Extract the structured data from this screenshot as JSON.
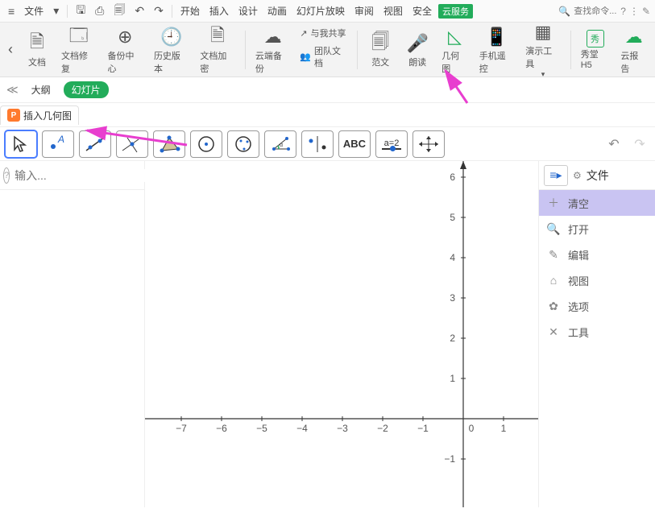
{
  "menubar": {
    "file": "文件",
    "tabs": [
      "开始",
      "插入",
      "设计",
      "动画",
      "幻灯片放映",
      "审阅",
      "视图",
      "安全"
    ],
    "cloud": "云服务",
    "search_placeholder": "查找命令..."
  },
  "ribbon": {
    "items": [
      {
        "label": "文档"
      },
      {
        "label": "文档修复"
      },
      {
        "label": "备份中心"
      },
      {
        "label": "历史版本"
      },
      {
        "label": "文档加密"
      },
      {
        "label": "云端备份"
      },
      {
        "label": "范文"
      },
      {
        "label": "朗读"
      },
      {
        "label": "几何图"
      },
      {
        "label": "手机遥控"
      },
      {
        "label": "演示工具"
      },
      {
        "label": "秀堂H5"
      },
      {
        "label": "云报告"
      }
    ],
    "small": {
      "share": "与我共享",
      "team": "团队文档"
    }
  },
  "subnav": {
    "outline": "大纲",
    "slide": "幻灯片"
  },
  "tab": {
    "title": "插入几何图"
  },
  "tools": {
    "text": "ABC",
    "slider": "a=2"
  },
  "leftpanel": {
    "placeholder": "输入..."
  },
  "rightmenu": {
    "head": "文件",
    "items": [
      "清空",
      "打开",
      "编辑",
      "视图",
      "选项",
      "工具"
    ]
  },
  "chart_data": {
    "type": "scatter",
    "title": "",
    "xlabel": "",
    "ylabel": "",
    "x_ticks": [
      -7,
      -6,
      -5,
      -4,
      -3,
      -2,
      -1,
      0,
      1
    ],
    "y_ticks": [
      -1,
      0,
      1,
      2,
      3,
      4,
      5,
      6
    ],
    "xlim": [
      -7.5,
      1.5
    ],
    "ylim": [
      -1.5,
      6.5
    ],
    "series": []
  }
}
